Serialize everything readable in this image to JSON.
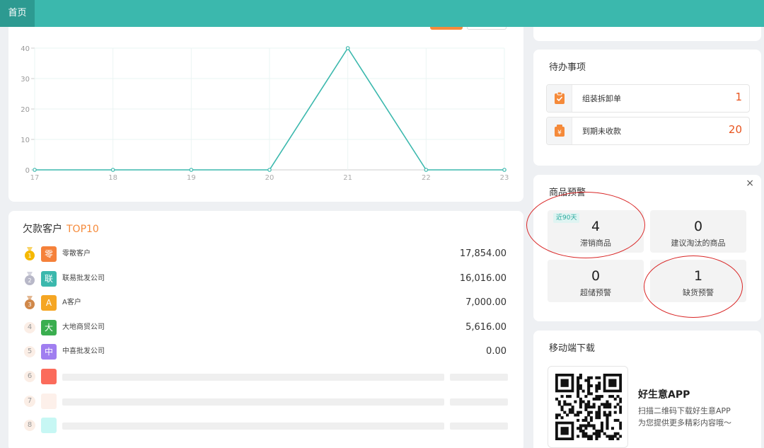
{
  "topbar": {
    "home_tab": "首页"
  },
  "chart_data": {
    "type": "line",
    "x": [
      17,
      18,
      19,
      20,
      21,
      22,
      23
    ],
    "series": [
      {
        "values": [
          0,
          0,
          0,
          0,
          40,
          0,
          0
        ],
        "color": "#3bb8ad"
      }
    ],
    "ylim": [
      0,
      40
    ],
    "yticks": [
      0,
      10,
      20,
      30,
      40
    ],
    "grid": true
  },
  "debt": {
    "title": "欠款客户",
    "title_accent": "TOP10",
    "rows": [
      {
        "rank": "1",
        "avatar": "零",
        "avatar_color": "#f5813a",
        "name": "零散客户",
        "amount": "17,854.00"
      },
      {
        "rank": "2",
        "avatar": "联",
        "avatar_color": "#3bb8ad",
        "name": "联易批发公司",
        "amount": "16,016.00"
      },
      {
        "rank": "3",
        "avatar": "A",
        "avatar_color": "#f5a623",
        "name": "A客户",
        "amount": "7,000.00"
      },
      {
        "rank": "4",
        "avatar": "大",
        "avatar_color": "#3aae4f",
        "name": "大地商贸公司",
        "amount": "5,616.00"
      },
      {
        "rank": "5",
        "avatar": "中",
        "avatar_color": "#a07ef0",
        "name": "中喜批发公司",
        "amount": "0.00"
      }
    ],
    "placeholder_rows": [
      {
        "rank": "6",
        "color": "#fb6b5b"
      },
      {
        "rank": "7",
        "color": "#fdf0ea"
      },
      {
        "rank": "8",
        "color": "#c7f7f4"
      }
    ]
  },
  "todo": {
    "title": "待办事项",
    "items": [
      {
        "label": "组装拆卸单",
        "count": "1"
      },
      {
        "label": "到期未收款",
        "count": "20"
      }
    ]
  },
  "alerts": {
    "title": "商品预警",
    "close": "×",
    "tiles": [
      {
        "badge": "近90天",
        "num": "4",
        "label": "滞销商品"
      },
      {
        "num": "0",
        "label": "建议淘汰的商品"
      },
      {
        "num": "0",
        "label": "超储预警"
      },
      {
        "num": "1",
        "label": "缺货预警"
      }
    ]
  },
  "mobile": {
    "title": "移动端下载",
    "app_name": "好生意APP",
    "line1": "扫描二维码下载好生意APP",
    "line2": "为您提供更多精彩内容哦～"
  },
  "colors": {
    "accent": "#3bb8ad",
    "orange": "#f58a3a",
    "count_red": "#e8541e"
  }
}
